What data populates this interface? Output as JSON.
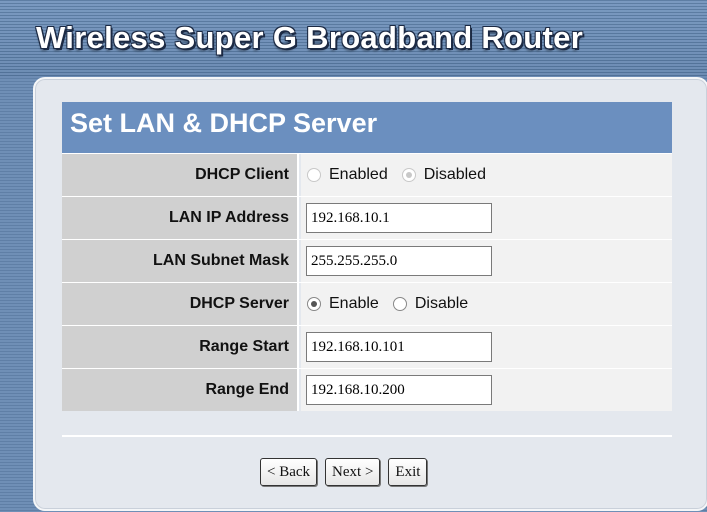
{
  "app_title": "Wireless Super G Broadband Router",
  "section_title": "Set LAN & DHCP Server",
  "fields": {
    "dhcp_client": {
      "label": "DHCP Client",
      "options": [
        "Enabled",
        "Disabled"
      ],
      "selected": "Disabled",
      "disabled": true
    },
    "lan_ip": {
      "label": "LAN IP Address",
      "value": "192.168.10.1"
    },
    "lan_mask": {
      "label": "LAN Subnet Mask",
      "value": "255.255.255.0"
    },
    "dhcp_server": {
      "label": "DHCP Server",
      "options": [
        "Enable",
        "Disable"
      ],
      "selected": "Enable"
    },
    "range_start": {
      "label": "Range Start",
      "value": "192.168.10.101"
    },
    "range_end": {
      "label": "Range End",
      "value": "192.168.10.200"
    }
  },
  "buttons": {
    "back": "< Back",
    "next": "Next >",
    "exit": "Exit"
  },
  "colors": {
    "header_bar": "#6b8fbf",
    "label_cell": "#d0d0d0",
    "value_cell": "#f2f2f2",
    "panel": "#e4e8ee"
  }
}
